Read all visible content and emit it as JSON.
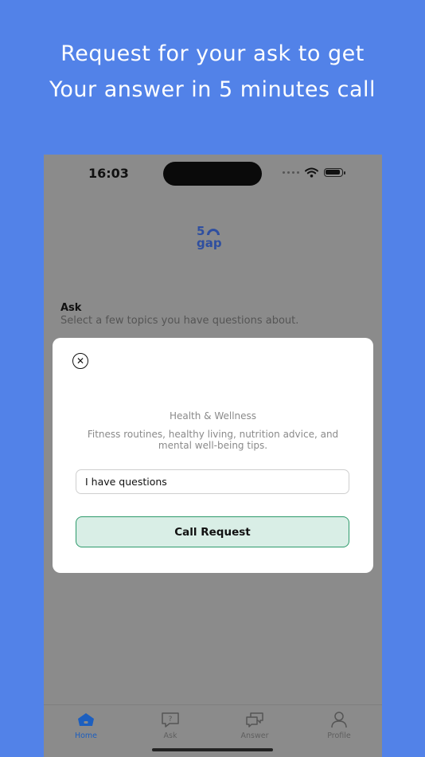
{
  "promo": {
    "line1": "Request for your ask to get",
    "line2": "Your answer in 5 minutes call"
  },
  "status_bar": {
    "time": "16:03"
  },
  "logo": {
    "top": "5",
    "bottom": "gap"
  },
  "ask_section": {
    "title": "Ask",
    "subtitle": "Select a few topics you have questions about."
  },
  "modal": {
    "close_icon": "close-icon",
    "topic_name": "Health & Wellness",
    "topic_description": "Fitness routines, healthy living, nutrition advice, and mental well-being tips.",
    "question_value": "I have questions",
    "call_button_label": "Call Request"
  },
  "tabs": [
    {
      "label": "Home",
      "icon": "home-icon",
      "active": true
    },
    {
      "label": "Ask",
      "icon": "question-bubble-icon",
      "active": false
    },
    {
      "label": "Answer",
      "icon": "chat-bubbles-icon",
      "active": false
    },
    {
      "label": "Profile",
      "icon": "person-icon",
      "active": false
    }
  ],
  "colors": {
    "background": "#5282e8",
    "accent": "#1d5fbf",
    "button_fill": "#d9eee6",
    "button_border": "#2d9a6b"
  }
}
